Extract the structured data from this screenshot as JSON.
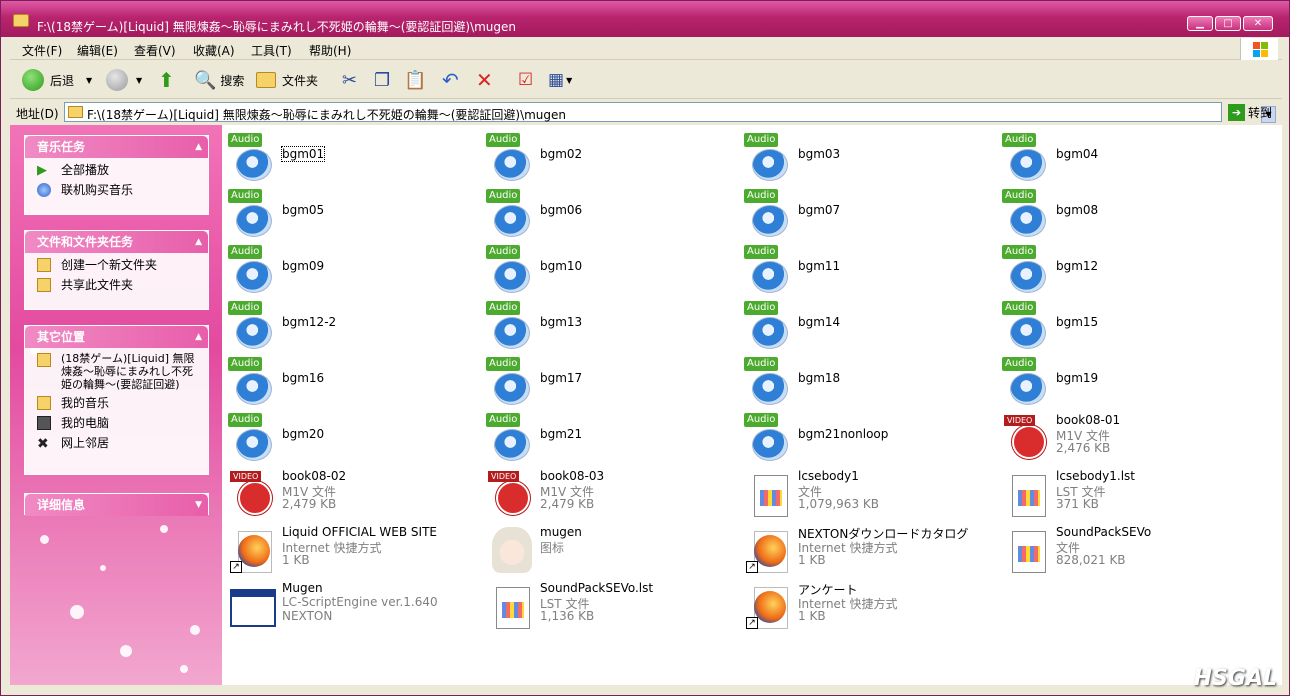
{
  "window": {
    "title": "F:\\(18禁ゲーム)[Liquid] 無限煉姦～恥辱にまみれし不死姫の輪舞～(要認証回避)\\mugen"
  },
  "menu": [
    "文件(F)",
    "编辑(E)",
    "查看(V)",
    "收藏(A)",
    "工具(T)",
    "帮助(H)"
  ],
  "toolbar": {
    "back": "后退",
    "search": "搜索",
    "folders": "文件夹"
  },
  "address": {
    "label": "地址(D)",
    "value": "F:\\(18禁ゲーム)[Liquid] 無限煉姦～恥辱にまみれし不死姫の輪舞～(要認証回避)\\mugen",
    "go": "转到"
  },
  "sidebar": {
    "music_tasks": {
      "title": "音乐任务",
      "items": [
        "全部播放",
        "联机购买音乐"
      ]
    },
    "file_tasks": {
      "title": "文件和文件夹任务",
      "items": [
        "创建一个新文件夹",
        "共享此文件夹"
      ]
    },
    "other_places": {
      "title": "其它位置",
      "items": [
        "(18禁ゲーム)[Liquid] 無限煉姦～恥辱にまみれし不死姫の輪舞～(要認証回避)",
        "我的音乐",
        "我的电脑",
        "网上邻居"
      ]
    },
    "details": {
      "title": "详细信息"
    }
  },
  "files": [
    {
      "name": "bgm01",
      "kind": "audio"
    },
    {
      "name": "bgm02",
      "kind": "audio"
    },
    {
      "name": "bgm03",
      "kind": "audio"
    },
    {
      "name": "bgm04",
      "kind": "audio"
    },
    {
      "name": "bgm05",
      "kind": "audio"
    },
    {
      "name": "bgm06",
      "kind": "audio"
    },
    {
      "name": "bgm07",
      "kind": "audio"
    },
    {
      "name": "bgm08",
      "kind": "audio"
    },
    {
      "name": "bgm09",
      "kind": "audio"
    },
    {
      "name": "bgm10",
      "kind": "audio"
    },
    {
      "name": "bgm11",
      "kind": "audio"
    },
    {
      "name": "bgm12",
      "kind": "audio"
    },
    {
      "name": "bgm12-2",
      "kind": "audio"
    },
    {
      "name": "bgm13",
      "kind": "audio"
    },
    {
      "name": "bgm14",
      "kind": "audio"
    },
    {
      "name": "bgm15",
      "kind": "audio"
    },
    {
      "name": "bgm16",
      "kind": "audio"
    },
    {
      "name": "bgm17",
      "kind": "audio"
    },
    {
      "name": "bgm18",
      "kind": "audio"
    },
    {
      "name": "bgm19",
      "kind": "audio"
    },
    {
      "name": "bgm20",
      "kind": "audio"
    },
    {
      "name": "bgm21",
      "kind": "audio"
    },
    {
      "name": "bgm21nonloop",
      "kind": "audio"
    },
    {
      "name": "book08-01",
      "kind": "video",
      "type": "M1V 文件",
      "size": "2,476 KB"
    },
    {
      "name": "book08-02",
      "kind": "video",
      "type": "M1V 文件",
      "size": "2,479 KB"
    },
    {
      "name": "book08-03",
      "kind": "video",
      "type": "M1V 文件",
      "size": "2,479 KB"
    },
    {
      "name": "lcsebody1",
      "kind": "doc",
      "type": "文件",
      "size": "1,079,963 KB"
    },
    {
      "name": "lcsebody1.lst",
      "kind": "doc",
      "type": "LST 文件",
      "size": "371 KB"
    },
    {
      "name": "Liquid OFFICIAL WEB SITE",
      "kind": "link",
      "type": "Internet 快捷方式",
      "size": "1 KB"
    },
    {
      "name": "mugen",
      "kind": "icon",
      "type": "图标",
      "size": ""
    },
    {
      "name": "NEXTONダウンロードカタログ",
      "kind": "link",
      "type": "Internet 快捷方式",
      "size": "1 KB"
    },
    {
      "name": "SoundPackSEVo",
      "kind": "doc",
      "type": "文件",
      "size": "828,021 KB"
    },
    {
      "name": "Mugen",
      "kind": "app",
      "type": "LC-ScriptEngine ver.1.640",
      "size": "NEXTON"
    },
    {
      "name": "SoundPackSEVo.lst",
      "kind": "doc",
      "type": "LST 文件",
      "size": "1,136 KB"
    },
    {
      "name": "アンケート",
      "kind": "link",
      "type": "Internet 快捷方式",
      "size": "1 KB"
    }
  ],
  "audio_tag": "Audio",
  "video_tag": "VIDEO",
  "watermark": "HSGAL",
  "colors": {
    "title_pink": "#b8246e",
    "sidebar_pink": "#e34a9f",
    "audio_green": "#4caa2e"
  }
}
